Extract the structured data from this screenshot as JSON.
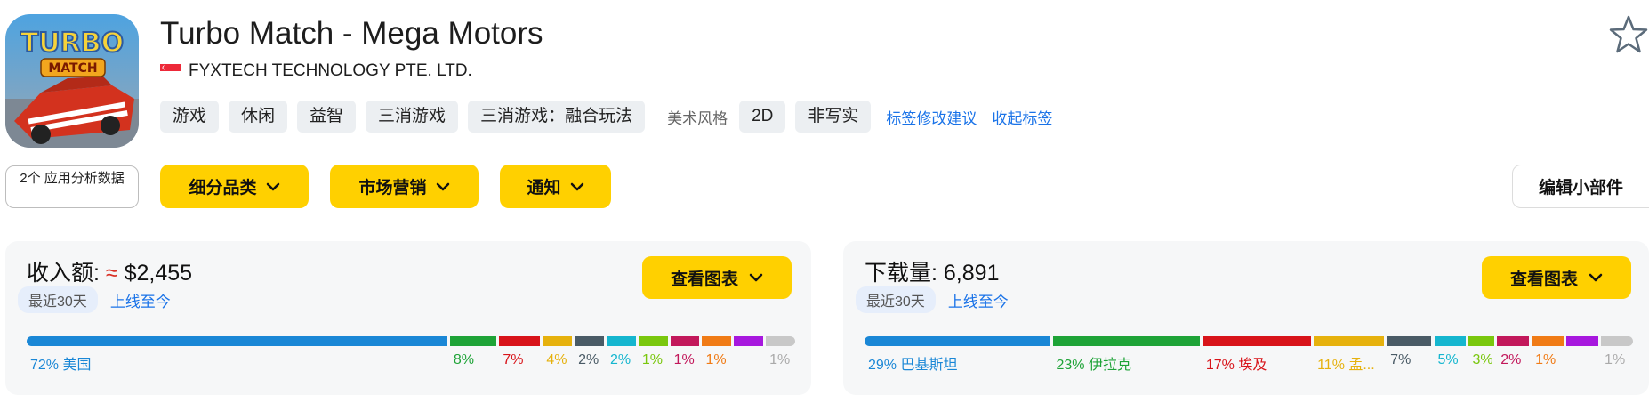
{
  "app": {
    "title": "Turbo Match - Mega Motors",
    "developer": "FYXTECH TECHNOLOGY PTE. LTD.",
    "icon_text_top": "TURBO",
    "icon_text_bottom": "MATCH"
  },
  "tags": {
    "items": [
      "游戏",
      "休闲",
      "益智",
      "三消游戏",
      "三消游戏：融合玩法"
    ],
    "art_style_label": "美术风格",
    "art_style_items": [
      "2D",
      "非写实"
    ],
    "suggest_link": "标签修改建议",
    "collapse_link": "收起标签"
  },
  "toolbar": {
    "apps_analysis": "2个 应用分析数据",
    "subcategory": "细分品类",
    "marketing": "市场营销",
    "notifications": "通知",
    "edit_widgets": "编辑小部件"
  },
  "revenue": {
    "label": "收入额:",
    "approx": "≈",
    "value": "$2,455",
    "range_active": "最近30天",
    "range_link": "上线至今",
    "chart_button": "查看图表",
    "segments": [
      {
        "pct": 72,
        "label": "72% 美国",
        "color": "#1a87d6"
      },
      {
        "pct": 8,
        "label": "8%",
        "color": "#1ea337"
      },
      {
        "pct": 7,
        "label": "7%",
        "color": "#d8141a"
      },
      {
        "pct": 5,
        "label": "4%",
        "color": "#e6b10d"
      },
      {
        "pct": 5,
        "label": "2%",
        "color": "#4a5b66"
      },
      {
        "pct": 5,
        "label": "2%",
        "color": "#15b6cf"
      },
      {
        "pct": 5,
        "label": "1%",
        "color": "#7ac70e"
      },
      {
        "pct": 5,
        "label": "1%",
        "color": "#c2185b"
      },
      {
        "pct": 5,
        "label": "1%",
        "color": "#f07b16"
      },
      {
        "pct": 5,
        "label": "",
        "color": "#a718de"
      },
      {
        "pct": 5,
        "label": "1%",
        "color": "#c8c8c8"
      }
    ]
  },
  "downloads": {
    "label": "下载量:",
    "value": "6,891",
    "range_active": "最近30天",
    "range_link": "上线至今",
    "chart_button": "查看图表",
    "segments": [
      {
        "pct": 29,
        "label": "29% 巴基斯坦",
        "color": "#1a87d6"
      },
      {
        "pct": 23,
        "label": "23% 伊拉克",
        "color": "#1ea337"
      },
      {
        "pct": 17,
        "label": "17% 埃及",
        "color": "#d8141a"
      },
      {
        "pct": 11,
        "label": "11% 孟...",
        "color": "#e6b10d"
      },
      {
        "pct": 7,
        "label": "7%",
        "color": "#4a5b66"
      },
      {
        "pct": 5,
        "label": "5%",
        "color": "#15b6cf"
      },
      {
        "pct": 4,
        "label": "3%",
        "color": "#7ac70e"
      },
      {
        "pct": 5,
        "label": "2%",
        "color": "#c2185b"
      },
      {
        "pct": 5,
        "label": "1%",
        "color": "#f07b16"
      },
      {
        "pct": 5,
        "label": "",
        "color": "#a718de"
      },
      {
        "pct": 5,
        "label": "1%",
        "color": "#c8c8c8"
      }
    ]
  }
}
